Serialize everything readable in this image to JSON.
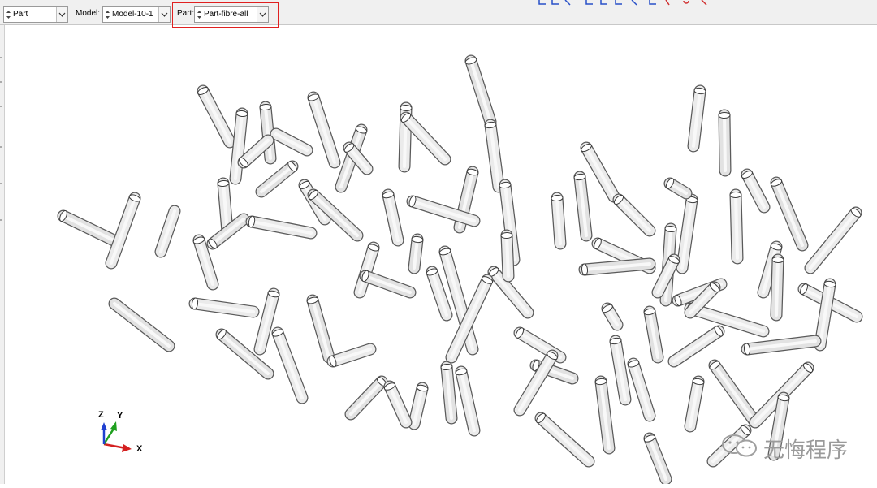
{
  "toolbar": {
    "module_value": "Part",
    "model_label": "Model:",
    "model_value": "Model-10-1",
    "part_label": "Part:",
    "part_value": "Part-fibre-all"
  },
  "triad": {
    "z": "Z",
    "y": "Y",
    "x": "X"
  },
  "watermark": {
    "text": "无悔程序"
  },
  "colors": {
    "highlight": "#e02020",
    "axis_x": "#d42020",
    "axis_y": "#20a020",
    "axis_z": "#2040d0"
  }
}
